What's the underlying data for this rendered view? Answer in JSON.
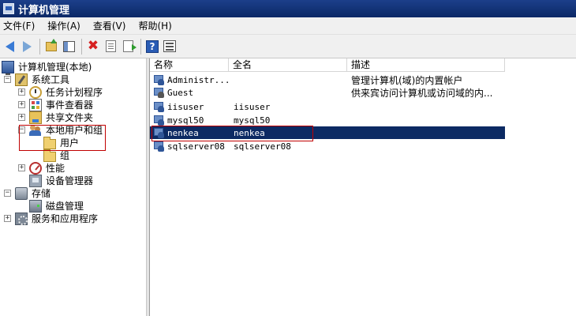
{
  "window": {
    "title": "计算机管理"
  },
  "menubar": {
    "items": [
      "文件(F)",
      "操作(A)",
      "查看(V)",
      "帮助(H)"
    ]
  },
  "toolbar": {
    "buttons": [
      "back-icon",
      "forward-icon",
      "folder-up-icon",
      "show-hide-tree-icon",
      "delete-icon",
      "properties-icon",
      "export-icon",
      "help-icon",
      "view-icon"
    ]
  },
  "tree": {
    "root": "计算机管理(本地)",
    "system_tools": "系统工具",
    "task_scheduler": "任务计划程序",
    "event_viewer": "事件查看器",
    "shared_folders": "共享文件夹",
    "local_users_groups": "本地用户和组",
    "users": "用户",
    "groups": "组",
    "performance": "性能",
    "device_manager": "设备管理器",
    "storage": "存储",
    "disk_management": "磁盘管理",
    "services_apps": "服务和应用程序"
  },
  "list": {
    "columns": {
      "name": "名称",
      "full_name": "全名",
      "description": "描述"
    },
    "rows": [
      {
        "name": "Administr...",
        "full_name": "",
        "description": "管理计算机(域)的内置帐户"
      },
      {
        "name": "Guest",
        "full_name": "",
        "description": "供来宾访问计算机或访问域的内..."
      },
      {
        "name": "iisuser",
        "full_name": "iisuser",
        "description": ""
      },
      {
        "name": "mysql50",
        "full_name": "mysql50",
        "description": ""
      },
      {
        "name": "nenkea",
        "full_name": "nenkea",
        "description": ""
      },
      {
        "name": "sqlserver08",
        "full_name": "sqlserver08",
        "description": ""
      }
    ],
    "selected_row": "nenkea"
  },
  "colors": {
    "titlebar": "#0b2866",
    "selection": "#0c2a63",
    "highlight_box": "#c00000"
  }
}
